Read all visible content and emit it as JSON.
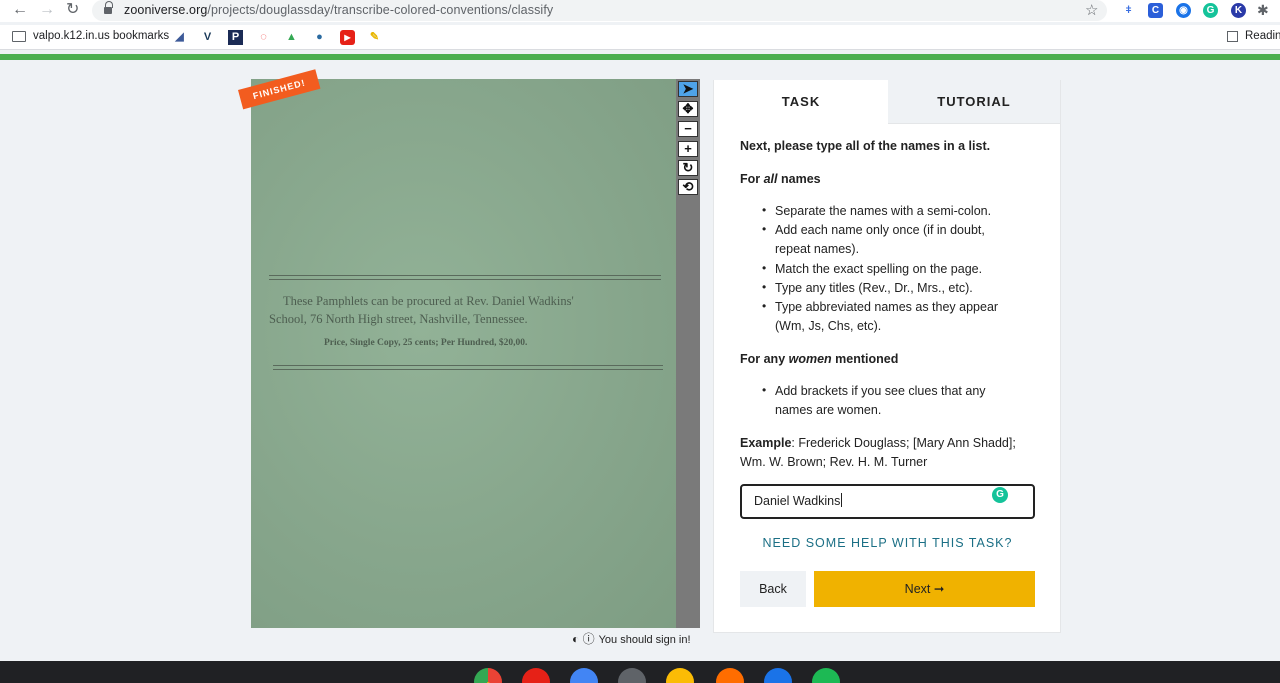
{
  "browser": {
    "url_domain": "zooniverse.org",
    "url_path": "/projects/douglassday/transcribe-colored-conventions/classify",
    "bookmarks_folder_label": "valpo.k12.in.us bookmarks",
    "reading_list_label": "Reading"
  },
  "subject": {
    "badge": "FINISHED!",
    "pamphlet_line1": "These Pamphlets can be procured at Rev. Daniel Wadkins'",
    "pamphlet_line2": "School, 76 North High street, Nashville, Tennessee.",
    "pamphlet_line3": "Price, Single Copy, 25 cents; Per Hundred, $20,00."
  },
  "signin": {
    "text": "You should sign in!"
  },
  "tabs": {
    "task": "TASK",
    "tutorial": "TUTORIAL"
  },
  "task": {
    "intro": "Next, please type all of the names in a list.",
    "all_heading_pre": "For ",
    "all_heading_em": "all",
    "all_heading_post": " names",
    "all_bullets": [
      "Separate the names with a semi-colon.",
      "Add each name only once (if in doubt,",
      "repeat names).",
      "Match the exact spelling on the page.",
      "Type any titles (Rev., Dr., Mrs., etc).",
      "Type abbreviated names as they appear",
      "(Wm, Js, Chs, etc)."
    ],
    "women_heading_pre": "For any ",
    "women_heading_em": "women",
    "women_heading_post": " mentioned",
    "women_bullets": [
      "Add brackets if you see clues that any",
      "names are women."
    ],
    "example_label": "Example",
    "example_line1": ": Frederick Douglass; [Mary Ann Shadd];",
    "example_line2": "Wm. W. Brown; Rev. H. M. Turner",
    "input_value": "Daniel Wadkins",
    "help_link": "NEED SOME HELP WITH THIS TASK?",
    "back_label": "Back",
    "next_label": "Next ➞"
  },
  "colors": {
    "next_button": "#f0b200",
    "help_link": "#1b6f85",
    "finished_badge": "#f25c1f",
    "active_tool": "#4fa3e8"
  }
}
